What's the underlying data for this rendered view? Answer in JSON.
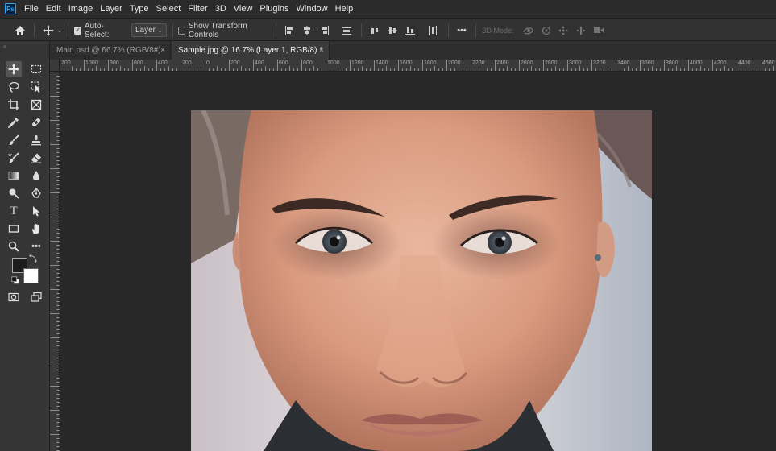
{
  "app": {
    "logo": "Ps"
  },
  "menu": [
    "File",
    "Edit",
    "Image",
    "Layer",
    "Type",
    "Select",
    "Filter",
    "3D",
    "View",
    "Plugins",
    "Window",
    "Help"
  ],
  "options_bar": {
    "home_icon": "home-icon",
    "move_icon": "move-icon",
    "auto_select_label": "Auto-Select:",
    "auto_select_checked": true,
    "layer_select_value": "Layer",
    "show_transform_label": "Show Transform Controls",
    "show_transform_checked": false,
    "more_label": "•••",
    "mode_3d_label": "3D Mode:"
  },
  "tabs": [
    {
      "label": "Main.psd @ 66.7% (RGB/8#)",
      "active": false
    },
    {
      "label": "Sample.jpg @ 16.7% (Layer 1, RGB/8) *",
      "active": true
    }
  ],
  "tab_close_glyph": "×",
  "ruler": {
    "horizontal_labels": [
      "200",
      "1000",
      "800",
      "600",
      "400",
      "200",
      "0",
      "200",
      "400",
      "600",
      "800",
      "1000",
      "1200",
      "1400",
      "1600",
      "1800",
      "2000",
      "2200",
      "2400",
      "2600",
      "2800",
      "3000",
      "3200",
      "3400",
      "3600",
      "3800",
      "4000",
      "4200",
      "4400",
      "4600"
    ]
  },
  "toolbar": {
    "more_tools_label": "•••",
    "type_tool_label": "T",
    "foreground_color": "#1d1d1d",
    "background_color": "#ffffff"
  },
  "document": {
    "name": "Sample.jpg",
    "zoom": "16.7%"
  },
  "colors": {
    "accent": "#31a8ff",
    "panel": "#353535",
    "canvas_bg": "#282828"
  }
}
